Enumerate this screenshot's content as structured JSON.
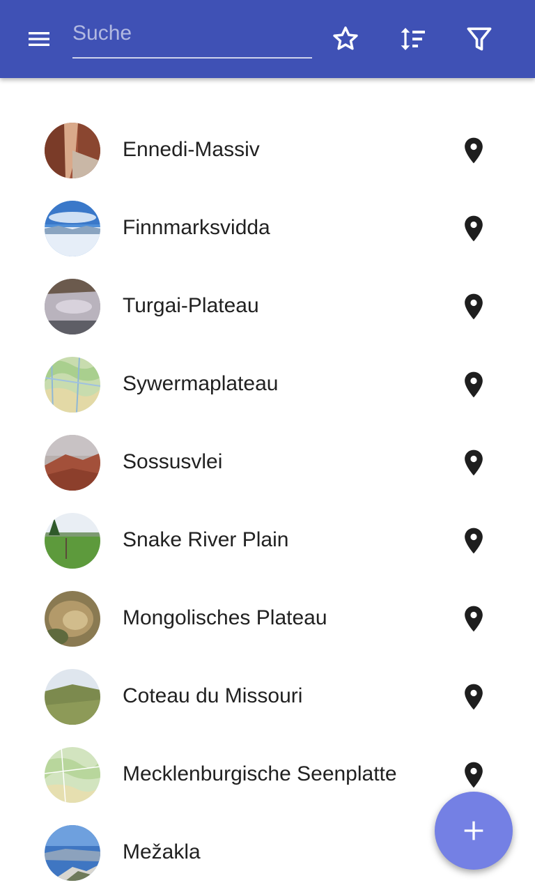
{
  "appbar": {
    "background": "#3f51b5",
    "menu_icon": "menu-icon",
    "search_placeholder": "Suche",
    "search_value": "",
    "favorites_icon": "star-outline-icon",
    "sort_icon": "sort-icon",
    "filter_icon": "filter-icon"
  },
  "places": [
    {
      "name": "Ennedi-Massiv",
      "icon": "map-marker-icon"
    },
    {
      "name": "Finnmarksvidda",
      "icon": "map-marker-icon"
    },
    {
      "name": "Turgai-Plateau",
      "icon": "map-marker-icon"
    },
    {
      "name": "Sywermaplateau",
      "icon": "map-marker-icon"
    },
    {
      "name": "Sossusvlei",
      "icon": "map-marker-icon"
    },
    {
      "name": "Snake River Plain",
      "icon": "map-marker-icon"
    },
    {
      "name": "Mongolisches Plateau",
      "icon": "map-marker-icon"
    },
    {
      "name": "Coteau du Missouri",
      "icon": "map-marker-icon"
    },
    {
      "name": "Mecklenburgische Seenplatte",
      "icon": "map-marker-icon"
    },
    {
      "name": "Mežakla",
      "icon": "map-marker-icon"
    }
  ],
  "fab": {
    "icon": "plus-icon",
    "color": "#7480e4"
  }
}
